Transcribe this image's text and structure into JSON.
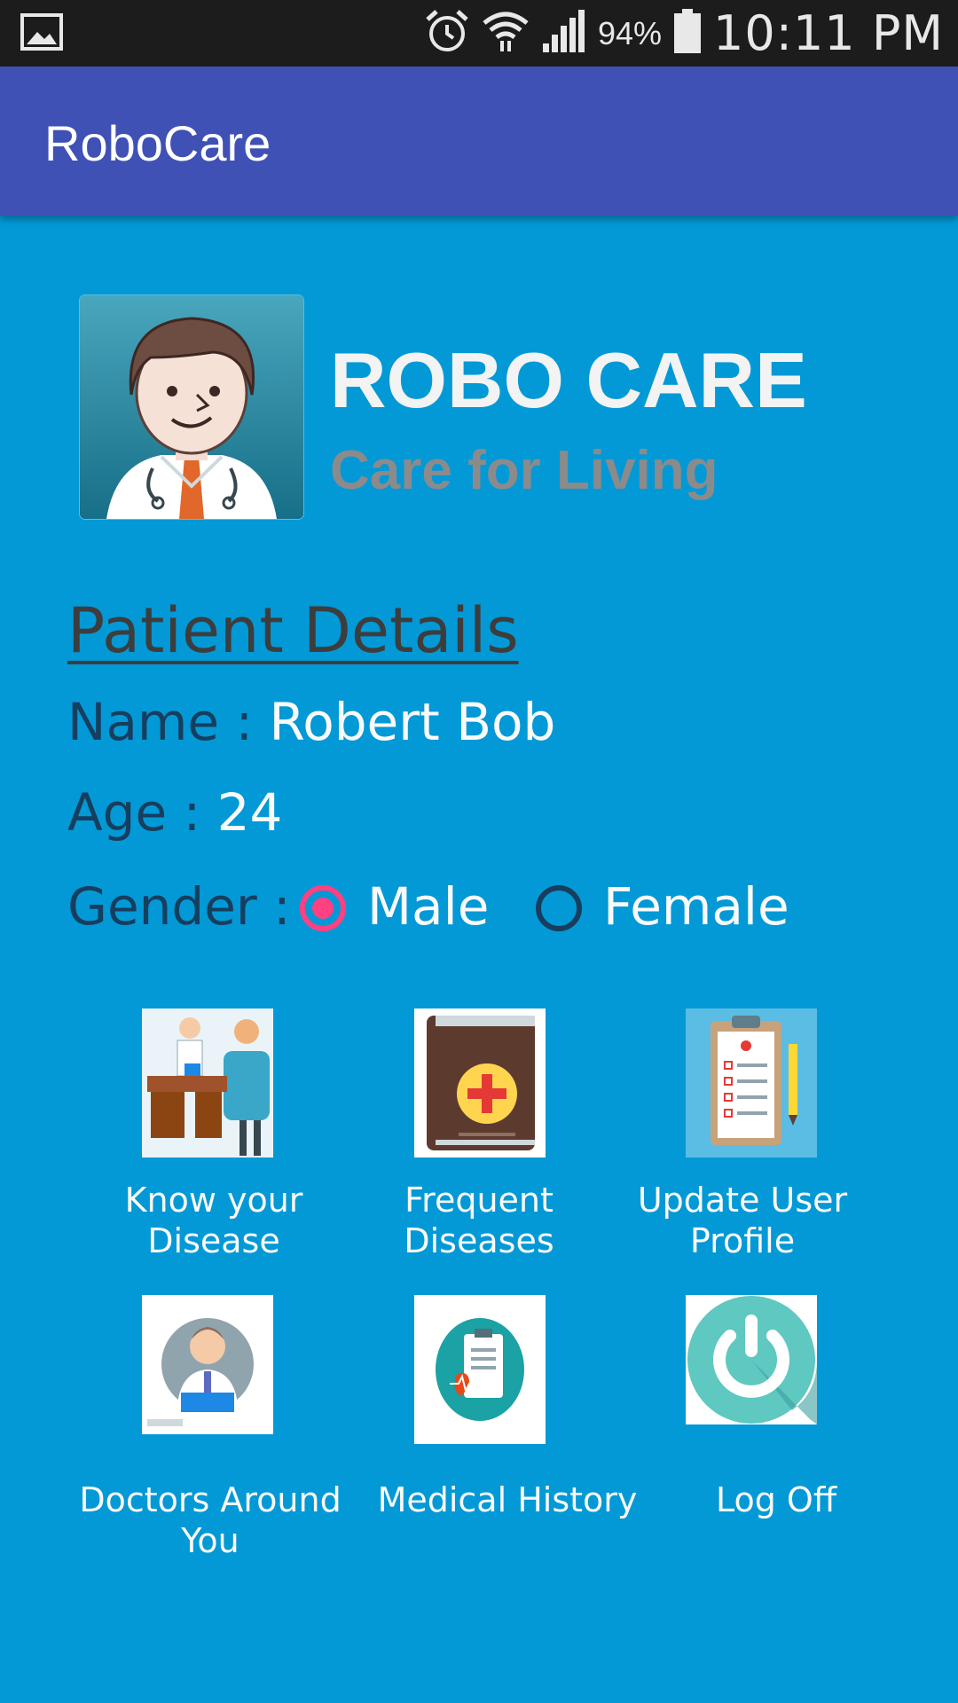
{
  "status_bar": {
    "gallery_icon": "image-icon",
    "alarm_icon": "alarm-icon",
    "wifi_icon": "wifi-icon",
    "signal_icon": "signal-icon",
    "battery_percent": "94%",
    "battery_icon": "battery-icon",
    "time": "10:11 PM"
  },
  "app_bar": {
    "title": "RoboCare"
  },
  "brand": {
    "logo_icon": "doctor-avatar-icon",
    "title": "ROBO CARE",
    "subtitle": "Care for Living"
  },
  "patient": {
    "heading": "Patient Details",
    "name_label": "Name : ",
    "name_value": "Robert Bob",
    "age_label": "Age : ",
    "age_value": "24",
    "gender_label": "Gender : ",
    "gender_options": [
      "Male",
      "Female"
    ],
    "gender_selected": "Male"
  },
  "menu": {
    "items": [
      {
        "label_1": "Know your",
        "label_2": "Disease",
        "icon": "doctor-consultation-icon"
      },
      {
        "label_1": "Frequent",
        "label_2": "Diseases",
        "icon": "medical-book-icon"
      },
      {
        "label_1": "Update User",
        "label_2": "Profile",
        "icon": "clipboard-icon"
      },
      {
        "label_1": "Doctors Around",
        "label_2": "You",
        "icon": "doctor-laptop-icon"
      },
      {
        "label_1": "Medical History",
        "label_2": "",
        "icon": "medical-report-icon"
      },
      {
        "label_1": "Log Off",
        "label_2": "",
        "icon": "power-icon"
      }
    ]
  },
  "colors": {
    "background": "#0399d6",
    "app_bar": "#3f51b5",
    "accent": "#ff4081",
    "status_bar": "#1c1c1c"
  }
}
